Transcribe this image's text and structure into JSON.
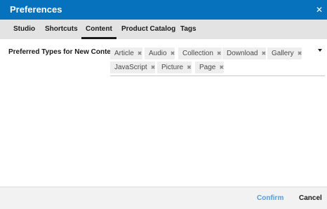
{
  "dialog": {
    "title": "Preferences",
    "close_glyph": "✕"
  },
  "tabs": [
    {
      "label": "Studio",
      "active": false
    },
    {
      "label": "Shortcuts",
      "active": false
    },
    {
      "label": "Content",
      "active": true
    },
    {
      "label": "Product Catalog",
      "active": false
    },
    {
      "label": "Tags",
      "active": false
    }
  ],
  "preferred_types": {
    "label": "Preferred Types for New Content:",
    "remove_glyph": "✖",
    "chips": [
      "Article",
      "Audio",
      "Collection",
      "Download",
      "Gallery",
      "JavaScript",
      "Picture",
      "Page"
    ],
    "dropdown_icon": "caret-down-icon"
  },
  "footer": {
    "confirm_label": "Confirm",
    "cancel_label": "Cancel"
  },
  "colors": {
    "titlebar": "#0672bd",
    "tabs_bg": "#e3e3e3",
    "chip_bg": "#eeeeee",
    "confirm_text": "#5a9bd8",
    "footer_bg": "#f2f2f2"
  }
}
